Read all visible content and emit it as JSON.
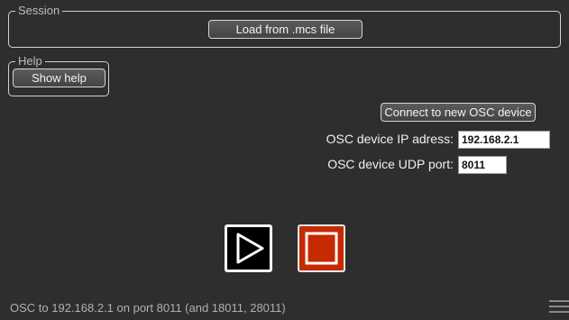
{
  "session": {
    "legend": "Session",
    "load_button": "Load from .mcs file"
  },
  "help": {
    "legend": "Help",
    "show_help_button": "Show help"
  },
  "osc": {
    "connect_button": "Connect to new OSC device",
    "ip_label": "OSC device IP adress:",
    "ip_value": "192.168.2.1",
    "port_label": "OSC device UDP port:",
    "port_value": "8011"
  },
  "transport": {
    "play_icon": "play-icon",
    "stop_icon": "stop-icon",
    "stop_color": "#c62a00"
  },
  "status": {
    "text": "OSC to 192.168.2.1 on port 8011 (and 18011, 28011)"
  },
  "menu": {
    "icon": "hamburger-menu-icon"
  }
}
